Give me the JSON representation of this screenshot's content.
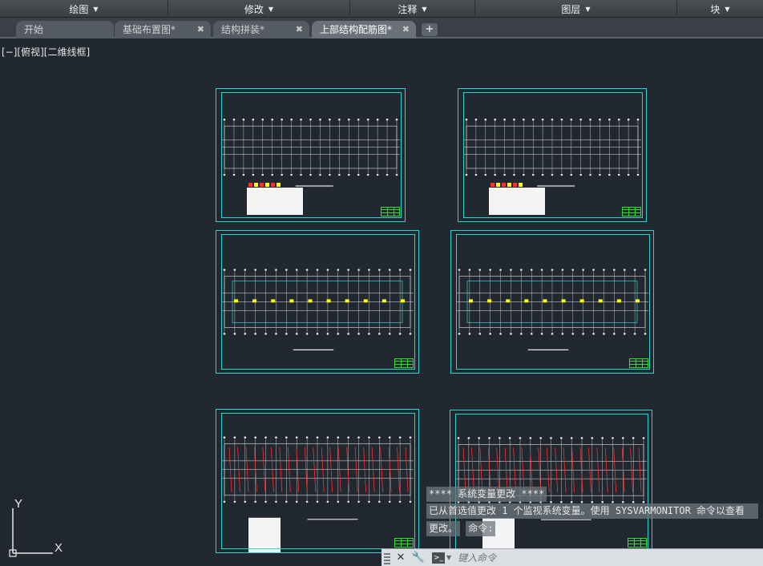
{
  "ribbon": {
    "panels": [
      "绘图",
      "修改",
      "注释",
      "图层",
      "块"
    ]
  },
  "tabs": {
    "start": "开始",
    "files": [
      "基础布置图*",
      "结构拼装*",
      "上部结构配筋图*"
    ]
  },
  "viewport": {
    "label": "[−][俯视][二维线框]"
  },
  "ucs": {
    "y_label": "Y",
    "x_label": "X"
  },
  "command": {
    "line1": "**** 系统变量更改 ****",
    "line2": "已从首选值更改 1 个监视系统变量。使用 SYSVARMONITOR 命令以查看",
    "line3": "更改。",
    "prompt": "命令:",
    "placeholder": "键入命令"
  },
  "colors": {
    "background": "#212830",
    "sheet_border": "#25d6d6",
    "grid_lines": "#e8e8e8",
    "annotation_yellow": "#ffff00",
    "rebar_red": "#ff3030",
    "titleblock_green": "#2ee02e"
  }
}
